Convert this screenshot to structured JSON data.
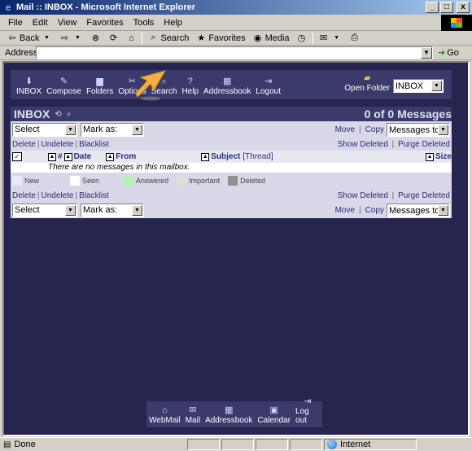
{
  "window": {
    "title": "Mail :: INBOX - Microsoft Internet Explorer",
    "minimize": "_",
    "maximize": "□",
    "close": "x"
  },
  "menu": [
    "File",
    "Edit",
    "View",
    "Favorites",
    "Tools",
    "Help"
  ],
  "toolbar": {
    "back": "Back",
    "search": "Search",
    "favorites": "Favorites",
    "media": "Media"
  },
  "address": {
    "label": "Address",
    "value": "",
    "go": "Go"
  },
  "mail_nav": {
    "items": [
      {
        "label": "INBOX",
        "icon": "inbox-icon",
        "glyph": "⬇"
      },
      {
        "label": "Compose",
        "icon": "compose-icon",
        "glyph": "✎"
      },
      {
        "label": "Folders",
        "icon": "folders-icon",
        "glyph": "▆"
      },
      {
        "label": "Options",
        "icon": "options-icon",
        "glyph": "✂"
      },
      {
        "label": "Search",
        "icon": "search-icon",
        "glyph": "⌕"
      },
      {
        "label": "Help",
        "icon": "help-icon",
        "glyph": "?"
      },
      {
        "label": "Addressbook",
        "icon": "addressbook-icon",
        "glyph": "▦"
      },
      {
        "label": "Logout",
        "icon": "logout-icon",
        "glyph": "⇥"
      }
    ],
    "open_folder_label": "Open Folder",
    "open_folder_value": "INBOX"
  },
  "inbox": {
    "title": "INBOX",
    "count": "0 of 0 Messages",
    "select_value": "Select",
    "mark_as_value": "Mark as:",
    "move": "Move",
    "copy": "Copy",
    "messages_to": "Messages to",
    "delete": "Delete",
    "undelete": "Undelete",
    "blacklist": "Blacklist",
    "show_deleted": "Show Deleted",
    "purge_deleted": "Purge Deleted",
    "col_num": "#",
    "col_date": "Date",
    "col_from": "From",
    "col_subject": "Subject",
    "col_thread": "[Thread]",
    "col_size": "Size",
    "empty_message": "There are no messages in this mailbox."
  },
  "legend": [
    {
      "label": "New",
      "color": "#e8e8f8"
    },
    {
      "label": "Seen",
      "color": "#ffffff"
    },
    {
      "label": "Answered",
      "color": "#b8f0b8"
    },
    {
      "label": "Important",
      "color": "#e0dcd8"
    },
    {
      "label": "Deleted",
      "color": "#909090"
    }
  ],
  "bottom_nav": [
    {
      "label": "WebMail",
      "icon": "webmail-icon",
      "glyph": "⌂"
    },
    {
      "label": "Mail",
      "icon": "mail-icon",
      "glyph": "✉"
    },
    {
      "label": "Addressbook",
      "icon": "addressbook-icon",
      "glyph": "▦"
    },
    {
      "label": "Calendar",
      "icon": "calendar-icon",
      "glyph": "▣"
    },
    {
      "label": "Log out",
      "icon": "logout-icon",
      "glyph": "⇥"
    }
  ],
  "status": {
    "text": "Done",
    "zone": "Internet"
  }
}
